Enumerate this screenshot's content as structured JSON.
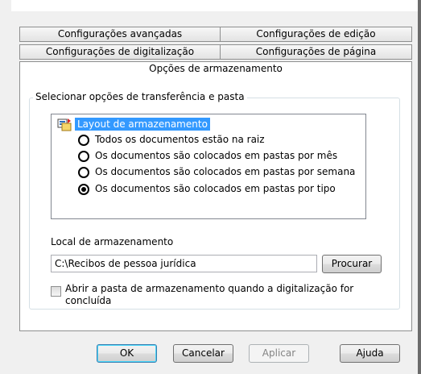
{
  "tabs": {
    "row1": [
      "Configurações avançadas",
      "Configurações de edição"
    ],
    "row2": [
      "Configurações de digitalização",
      "Configurações de página"
    ],
    "active": "Opções de armazenamento"
  },
  "group": {
    "label": "Selecionar opções de transferência e pasta",
    "tree_root": "Layout de armazenamento",
    "options": [
      {
        "label": "Todos os documentos estão na raiz",
        "selected": false
      },
      {
        "label": "Os documentos são colocados em pastas por mês",
        "selected": false
      },
      {
        "label": "Os documentos são colocados em pastas por semana",
        "selected": false
      },
      {
        "label": "Os documentos são colocados em pastas por tipo",
        "selected": true
      }
    ],
    "location_label": "Local de armazenamento",
    "location_value": "C:\\Recibos de pessoa jurídica",
    "browse_label": "Procurar",
    "checkbox_label": "Abrir a pasta de armazenamento quando a digitalização for concluída",
    "checkbox_checked": false
  },
  "buttons": {
    "ok": "OK",
    "cancel": "Cancelar",
    "apply": "Aplicar",
    "help": "Ajuda"
  },
  "icons": {
    "tree_root": "folder-layout-icon"
  }
}
